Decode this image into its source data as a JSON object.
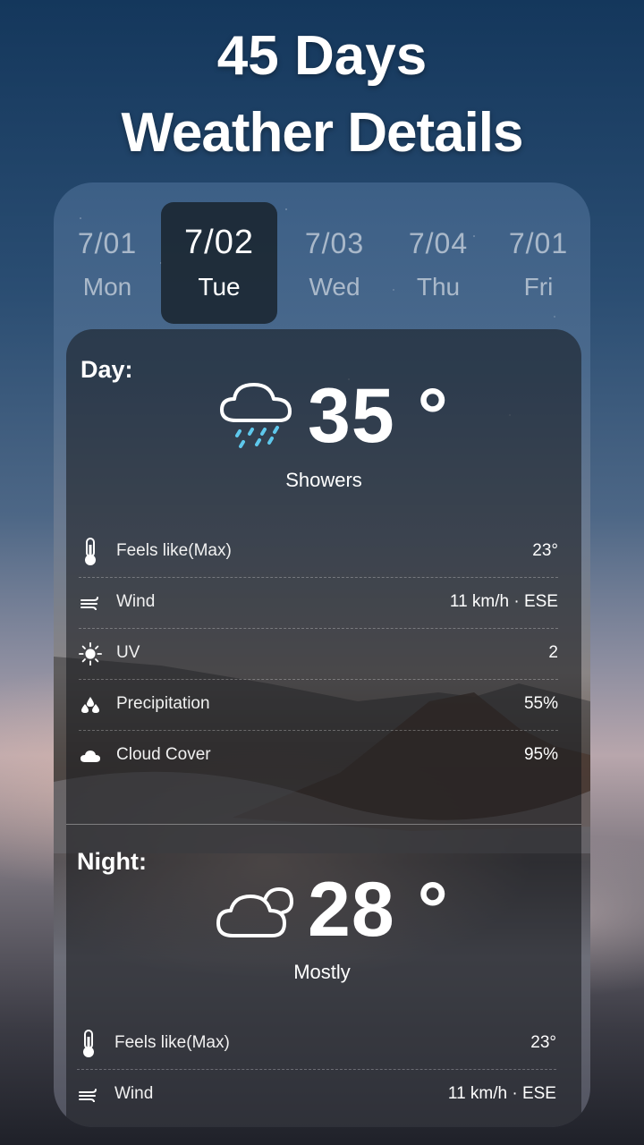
{
  "headline": {
    "line1": "45 Days",
    "line2": "Weather Details"
  },
  "dates": [
    {
      "date": "7/01",
      "weekday": "Mon"
    },
    {
      "date": "7/02",
      "weekday": "Tue"
    },
    {
      "date": "7/03",
      "weekday": "Wed"
    },
    {
      "date": "7/04",
      "weekday": "Thu"
    },
    {
      "date": "7/01",
      "weekday": "Fri"
    }
  ],
  "day": {
    "label": "Day:",
    "temperature": "35 °",
    "condition": "Showers",
    "icon": "cloud-rain-icon",
    "details": [
      {
        "label": "Feels like(Max)",
        "value": "23°",
        "icon": "thermometer-icon"
      },
      {
        "label": "Wind",
        "value": "11 km/h · ESE",
        "icon": "wind-icon"
      },
      {
        "label": "UV",
        "value": "2",
        "icon": "sun-icon"
      },
      {
        "label": "Precipitation",
        "value": "55%",
        "icon": "droplets-icon"
      },
      {
        "label": "Cloud Cover",
        "value": "95%",
        "icon": "cloud-icon"
      }
    ]
  },
  "night": {
    "label": "Night:",
    "temperature": "28 °",
    "condition": "Mostly",
    "icon": "clouds-icon",
    "details": [
      {
        "label": "Feels like(Max)",
        "value": "23°",
        "icon": "thermometer-icon"
      },
      {
        "label": "Wind",
        "value": "11 km/h · ESE",
        "icon": "wind-icon"
      }
    ]
  },
  "colors": {
    "selected_date_bg": "#19232d",
    "rain_drops": "#5ec8ec"
  }
}
